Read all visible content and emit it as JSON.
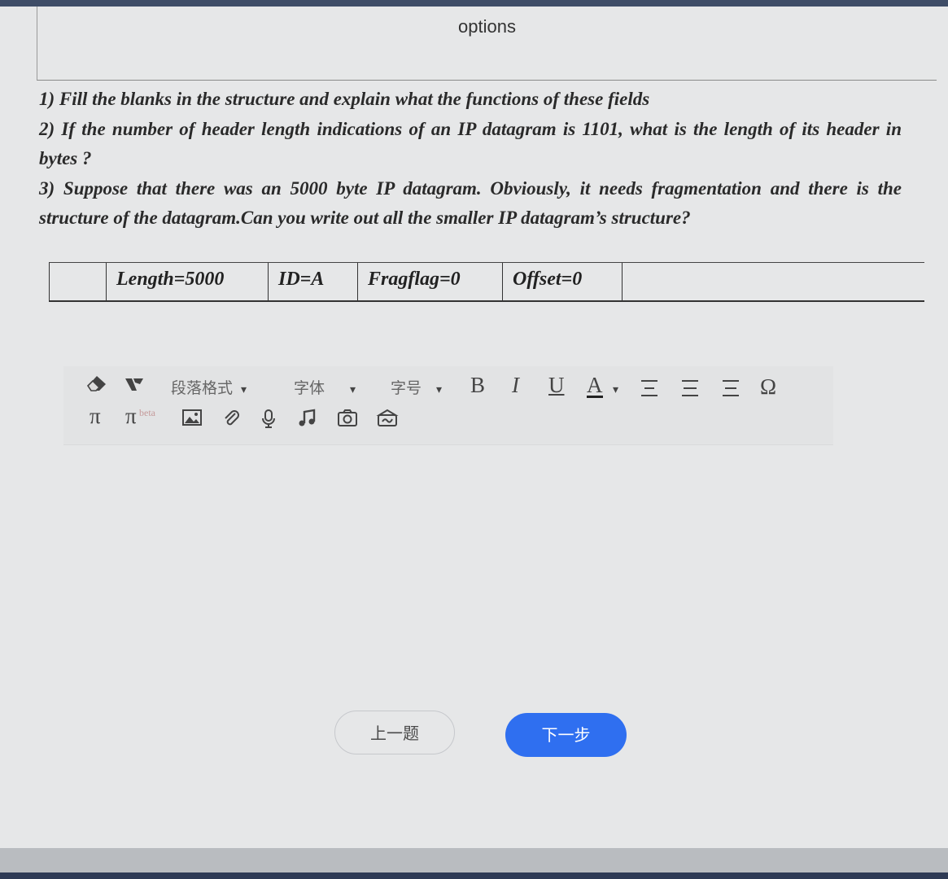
{
  "options": {
    "label": "options"
  },
  "question": {
    "q1": "1) Fill the blanks in the structure and explain what the functions of these fields",
    "q2": "2) If the number of header length indications of an IP datagram is 1101, what is the length of its header in bytes ?",
    "q3": "3) Suppose that there was an 5000 byte IP datagram. Obviously, it needs fragmentation and there is the structure of the datagram.Can you write out all the smaller IP datagram’s structure?"
  },
  "datagram": {
    "cells": [
      "",
      "Length=5000",
      "ID=A",
      "Fragflag=0",
      "Offset=0",
      ""
    ]
  },
  "toolbar": {
    "paragraph_format": "段落格式",
    "font": "字体",
    "font_size": "字号",
    "bold": "B",
    "italic": "I",
    "underline": "U",
    "font_color": "A",
    "omega": "Ω",
    "pi": "π",
    "pi_beta": "π",
    "beta": "beta",
    "dropdown": "▾"
  },
  "buttons": {
    "prev": "上一题",
    "next": "下一步"
  },
  "colors": {
    "next_button": "#2f6ff0",
    "top_bar": "#3f4d67"
  }
}
